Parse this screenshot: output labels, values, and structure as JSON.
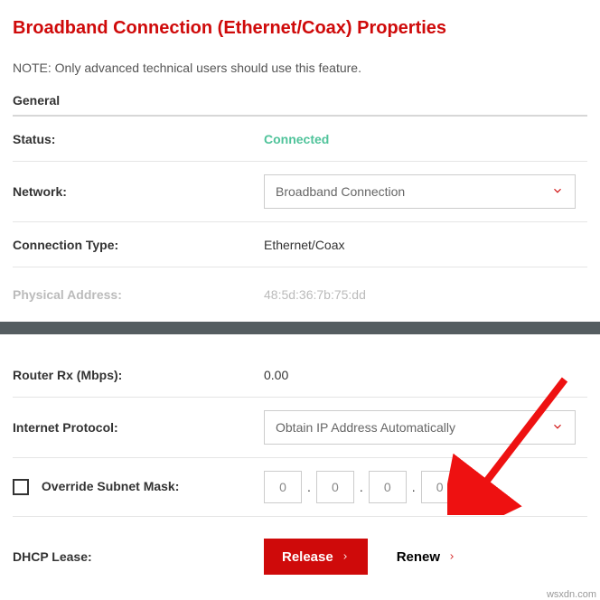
{
  "title": "Broadband Connection (Ethernet/Coax) Properties",
  "note": "NOTE: Only advanced technical users should use this feature.",
  "sections": {
    "general": "General"
  },
  "fields": {
    "status": {
      "label": "Status:",
      "value": "Connected"
    },
    "network": {
      "label": "Network:",
      "value": "Broadband Connection"
    },
    "connectionType": {
      "label": "Connection Type:",
      "value": "Ethernet/Coax"
    },
    "physicalAddress": {
      "label": "Physical Address:",
      "value": "48:5d:36:7b:75:dd"
    },
    "routerRx": {
      "label": "Router Rx (Mbps):",
      "value": "0.00"
    },
    "internetProtocol": {
      "label": "Internet Protocol:",
      "value": "Obtain IP Address Automatically"
    },
    "overrideSubnet": {
      "label": "Override Subnet Mask:",
      "octets": [
        "0",
        "0",
        "0",
        "0"
      ]
    },
    "dhcpLease": {
      "label": "DHCP Lease:"
    }
  },
  "buttons": {
    "release": "Release",
    "renew": "Renew"
  },
  "watermark": "wsxdn.com"
}
